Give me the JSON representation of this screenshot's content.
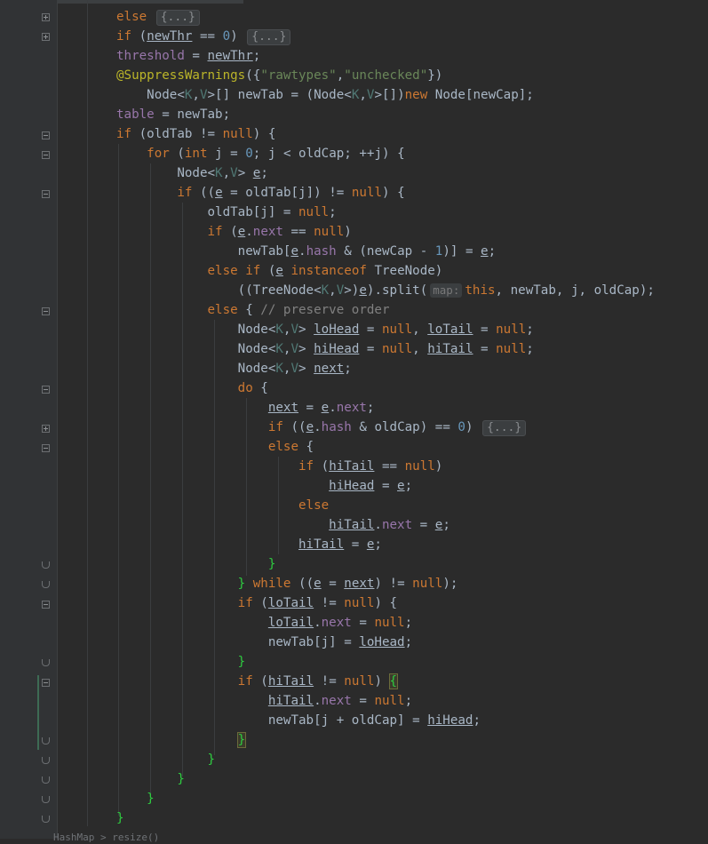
{
  "editor": {
    "lines": [
      {
        "html": "<span class='kw'>else</span> <span class='collapsed'>{...}</span>"
      },
      {
        "html": "<span class='kw'>if</span> (<span class='u'>newThr</span> == <span class='num'>0</span>) <span class='collapsed'>{...}</span>"
      },
      {
        "html": "<span class='fld'>threshold</span> = <span class='u'>newThr</span>;"
      },
      {
        "html": "<span class='ann'>@SuppressWarnings</span>({<span class='str'>\"rawtypes\"</span>,<span class='str'>\"unchecked\"</span>})"
      },
      {
        "html": "    Node&lt;<span class='tp'>K</span>,<span class='tp'>V</span>&gt;[] newTab = (Node&lt;<span class='tp'>K</span>,<span class='tp'>V</span>&gt;[])<span class='kw'>new</span> Node[newCap];"
      },
      {
        "html": "<span class='fld'>table</span> = newTab;"
      },
      {
        "html": "<span class='kw'>if</span> (oldTab != <span class='kw'>null</span>) {"
      },
      {
        "html": "    <span class='kw'>for</span> (<span class='kw'>int</span> j = <span class='num'>0</span>; j &lt; oldCap; ++j) {"
      },
      {
        "html": "        Node&lt;<span class='tp'>K</span>,<span class='tp'>V</span>&gt; <span class='u'>e</span>;"
      },
      {
        "html": "        <span class='kw'>if</span> ((<span class='u'>e</span> = oldTab[j]) != <span class='kw'>null</span>) {"
      },
      {
        "html": "            oldTab[j] = <span class='kw'>null</span>;"
      },
      {
        "html": "            <span class='kw'>if</span> (<span class='u'>e</span>.<span class='fld'>next</span> == <span class='kw'>null</span>)"
      },
      {
        "html": "                newTab[<span class='u'>e</span>.<span class='fld'>hash</span> &amp; (newCap - <span class='num'>1</span>)] = <span class='u'>e</span>;"
      },
      {
        "html": "            <span class='kw'>else if</span> (<span class='u'>e</span> <span class='kw'>instanceof</span> TreeNode)"
      },
      {
        "html": "                ((TreeNode&lt;<span class='tp'>K</span>,<span class='tp'>V</span>&gt;)<span class='u'>e</span>).split(<span class='hint'>map:</span><span class='kw'>this</span>, newTab, j, oldCap);"
      },
      {
        "html": "            <span class='kw'>else</span> { <span class='cmt'>// preserve order</span>"
      },
      {
        "html": "                Node&lt;<span class='tp'>K</span>,<span class='tp'>V</span>&gt; <span class='u'>loHead</span> = <span class='kw'>null</span>, <span class='u'>loTail</span> = <span class='kw'>null</span>;"
      },
      {
        "html": "                Node&lt;<span class='tp'>K</span>,<span class='tp'>V</span>&gt; <span class='u'>hiHead</span> = <span class='kw'>null</span>, <span class='u'>hiTail</span> = <span class='kw'>null</span>;"
      },
      {
        "html": "                Node&lt;<span class='tp'>K</span>,<span class='tp'>V</span>&gt; <span class='u'>next</span>;"
      },
      {
        "html": "                <span class='kw'>do</span> {"
      },
      {
        "html": "                    <span class='u'>next</span> = <span class='u'>e</span>.<span class='fld'>next</span>;"
      },
      {
        "html": "                    <span class='kw'>if</span> ((<span class='u'>e</span>.<span class='fld'>hash</span> &amp; oldCap) == <span class='num'>0</span>) <span class='collapsed'>{...}</span>"
      },
      {
        "html": "                    <span class='kw'>else</span> {"
      },
      {
        "html": "                        <span class='kw'>if</span> (<span class='u'>hiTail</span> == <span class='kw'>null</span>)"
      },
      {
        "html": "                            <span class='u'>hiHead</span> = <span class='u'>e</span>;"
      },
      {
        "html": "                        <span class='kw'>else</span>"
      },
      {
        "html": "                            <span class='u'>hiTail</span>.<span class='fld'>next</span> = <span class='u'>e</span>;"
      },
      {
        "html": "                        <span class='u'>hiTail</span> = <span class='u'>e</span>;"
      },
      {
        "html": "                    <span class='br'>}</span>"
      },
      {
        "html": "                <span class='br'>}</span> <span class='kw'>while</span> ((<span class='u'>e</span> = <span class='u'>next</span>) != <span class='kw'>null</span>);"
      },
      {
        "html": "                <span class='kw'>if</span> (<span class='u'>loTail</span> != <span class='kw'>null</span>) {"
      },
      {
        "html": "                    <span class='u'>loTail</span>.<span class='fld'>next</span> = <span class='kw'>null</span>;"
      },
      {
        "html": "                    newTab[j] = <span class='u'>loHead</span>;"
      },
      {
        "html": "                <span class='br'>}</span>"
      },
      {
        "html": "                <span class='kw'>if</span> (<span class='u'>hiTail</span> != <span class='kw'>null</span>) <span class='caretbox br'>{</span>"
      },
      {
        "html": "                    <span class='u'>hiTail</span>.<span class='fld'>next</span> = <span class='kw'>null</span>;"
      },
      {
        "html": "                    newTab[j + oldCap] = <span class='u'>hiHead</span>;"
      },
      {
        "html": "                <span class='caretbox br'>}</span>"
      },
      {
        "html": "            <span class='br'>}</span>"
      },
      {
        "html": "        <span class='br'>}</span>"
      },
      {
        "html": "    <span class='br'>}</span>"
      },
      {
        "html": "<span class='br'>}</span>"
      }
    ],
    "breadcrumb": "HashMap > resize()"
  }
}
